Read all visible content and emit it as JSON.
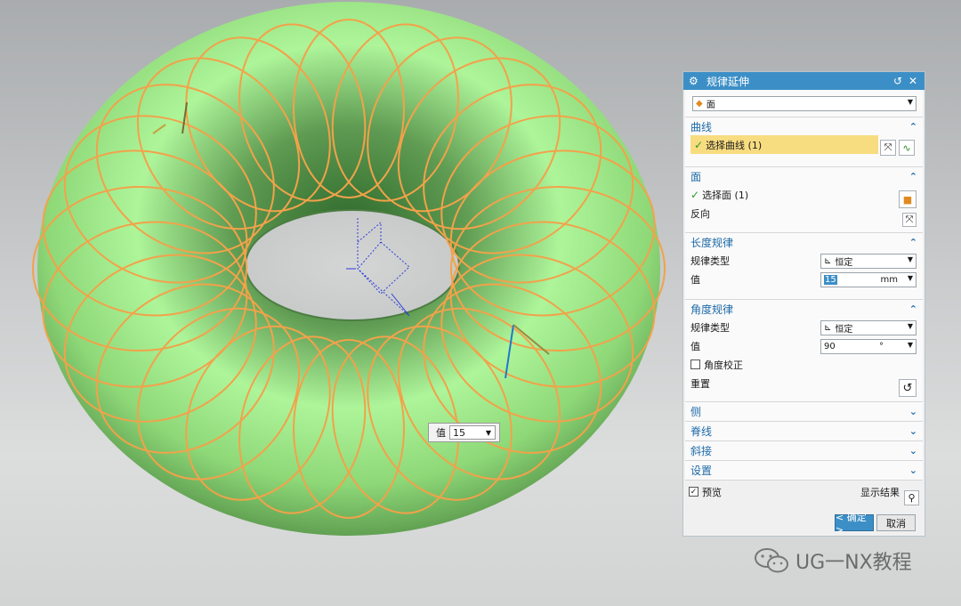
{
  "dialog": {
    "title": "规律延伸",
    "type_select": "面",
    "sections": {
      "curve": {
        "header": "曲线",
        "select_label": "选择曲线 (1)"
      },
      "face": {
        "header": "面",
        "select_label": "选择面 (1)",
        "reverse_label": "反向"
      },
      "length_law": {
        "header": "长度规律",
        "law_type_label": "规律类型",
        "law_type_value": "恒定",
        "value_label": "值",
        "value": "15",
        "unit": "mm"
      },
      "angle_law": {
        "header": "角度规律",
        "law_type_label": "规律类型",
        "law_type_value": "恒定",
        "value_label": "值",
        "value": "90",
        "unit": "°",
        "angle_correction_label": "角度校正",
        "reset_label": "重置"
      },
      "side": {
        "header": "侧"
      },
      "spine": {
        "header": "脊线"
      },
      "miter": {
        "header": "斜接"
      },
      "settings": {
        "header": "设置"
      }
    },
    "preview_label": "预览",
    "show_result_label": "显示结果",
    "ok_label": "< 确定 >",
    "cancel_label": "取消"
  },
  "float_input": {
    "label": "值",
    "value": "15"
  },
  "watermark": "UG一NX教程",
  "colors": {
    "titlebar": "#3c8fc6",
    "accent": "#1e6aa8",
    "selection": "#f8dc80",
    "torus_light": "#aef59a",
    "torus_dark": "#3d7a34",
    "curve": "#f2a24a"
  }
}
